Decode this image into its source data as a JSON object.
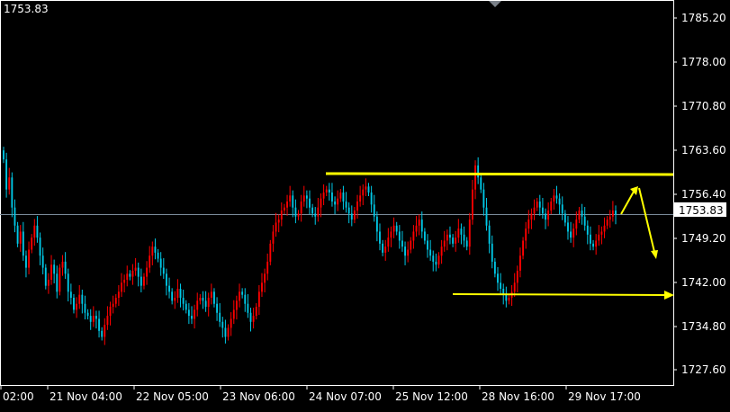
{
  "header": {
    "current_price_text": "1753.83"
  },
  "price_axis": {
    "labels": [
      "1785.20",
      "1778.00",
      "1770.80",
      "1763.60",
      "1756.40",
      "1749.20",
      "1742.00",
      "1734.80",
      "1727.60"
    ],
    "current_price_badge": "1753.83"
  },
  "time_axis": {
    "labels": [
      "02:00",
      "21 Nov 04:00",
      "22 Nov 05:00",
      "23 Nov 06:00",
      "24 Nov 07:00",
      "25 Nov 12:00",
      "28 Nov 16:00",
      "29 Nov 17:00"
    ]
  },
  "colors": {
    "background": "#000000",
    "bull": "#ff0000",
    "bear": "#00c8e6",
    "annotation": "#ffff00",
    "axis": "#ffffff",
    "current_price_line": "#7a8a99"
  },
  "icons": {
    "scroll_marker": "triangle-down-icon"
  },
  "chart_data": {
    "type": "candlestick",
    "y_range": [
      1725.5,
      1789.5
    ],
    "current_price": 1753.83,
    "resistance_level": 1759.2,
    "support_level": 1739.9,
    "closes": [
      1763.0,
      1758.0,
      1760.0,
      1755.0,
      1752.0,
      1749.0,
      1751.0,
      1747.0,
      1745.0,
      1748.0,
      1750.0,
      1752.0,
      1750.0,
      1747.0,
      1745.0,
      1742.0,
      1743.0,
      1745.5,
      1744.0,
      1741.0,
      1745.0,
      1746.0,
      1744.0,
      1741.0,
      1740.0,
      1738.0,
      1739.0,
      1740.5,
      1739.0,
      1737.5,
      1737.0,
      1736.0,
      1737.0,
      1736.5,
      1734.5,
      1733.5,
      1735.5,
      1737.0,
      1738.5,
      1739.0,
      1740.0,
      1741.0,
      1742.5,
      1743.0,
      1744.0,
      1743.5,
      1744.5,
      1745.0,
      1743.5,
      1742.0,
      1743.5,
      1745.0,
      1747.0,
      1748.5,
      1747.5,
      1746.5,
      1745.0,
      1744.0,
      1742.0,
      1741.0,
      1739.5,
      1740.0,
      1741.5,
      1740.0,
      1739.0,
      1738.0,
      1737.0,
      1736.5,
      1738.0,
      1739.5,
      1740.0,
      1739.5,
      1738.5,
      1740.0,
      1741.0,
      1739.0,
      1737.5,
      1736.0,
      1735.0,
      1733.5,
      1735.0,
      1736.5,
      1738.0,
      1739.5,
      1741.0,
      1740.5,
      1739.0,
      1737.5,
      1736.0,
      1737.0,
      1738.5,
      1741.0,
      1742.5,
      1744.0,
      1746.0,
      1749.0,
      1751.0,
      1752.5,
      1753.0,
      1754.5,
      1755.0,
      1756.0,
      1757.0,
      1755.0,
      1753.5,
      1754.0,
      1756.0,
      1757.0,
      1756.5,
      1755.0,
      1754.0,
      1753.5,
      1755.0,
      1756.5,
      1757.5,
      1758.0,
      1757.5,
      1756.0,
      1755.5,
      1756.5,
      1757.5,
      1756.0,
      1755.0,
      1754.0,
      1753.0,
      1754.5,
      1756.0,
      1757.0,
      1758.0,
      1758.5,
      1757.5,
      1755.5,
      1753.5,
      1751.0,
      1749.0,
      1747.5,
      1748.5,
      1750.0,
      1751.0,
      1752.0,
      1751.0,
      1749.5,
      1748.5,
      1747.0,
      1748.0,
      1749.5,
      1751.0,
      1752.0,
      1753.0,
      1751.0,
      1749.5,
      1748.0,
      1747.0,
      1746.0,
      1745.5,
      1747.0,
      1748.5,
      1749.5,
      1750.5,
      1750.0,
      1749.0,
      1750.0,
      1751.5,
      1750.5,
      1749.5,
      1748.5,
      1753.0,
      1758.0,
      1762.0,
      1760.0,
      1758.0,
      1755.0,
      1752.0,
      1749.0,
      1746.0,
      1744.0,
      1742.5,
      1741.5,
      1740.5,
      1739.5,
      1740.0,
      1741.0,
      1742.5,
      1744.5,
      1747.0,
      1749.5,
      1751.5,
      1753.0,
      1754.0,
      1755.0,
      1756.0,
      1755.0,
      1754.0,
      1753.0,
      1754.5,
      1756.0,
      1757.0,
      1756.5,
      1755.5,
      1754.0,
      1752.5,
      1751.0,
      1750.0,
      1751.5,
      1753.0,
      1754.5,
      1753.5,
      1752.0,
      1750.5,
      1749.0,
      1748.5,
      1749.5,
      1750.5,
      1751.0,
      1752.0,
      1753.0,
      1753.5,
      1754.5,
      1753.83
    ]
  }
}
